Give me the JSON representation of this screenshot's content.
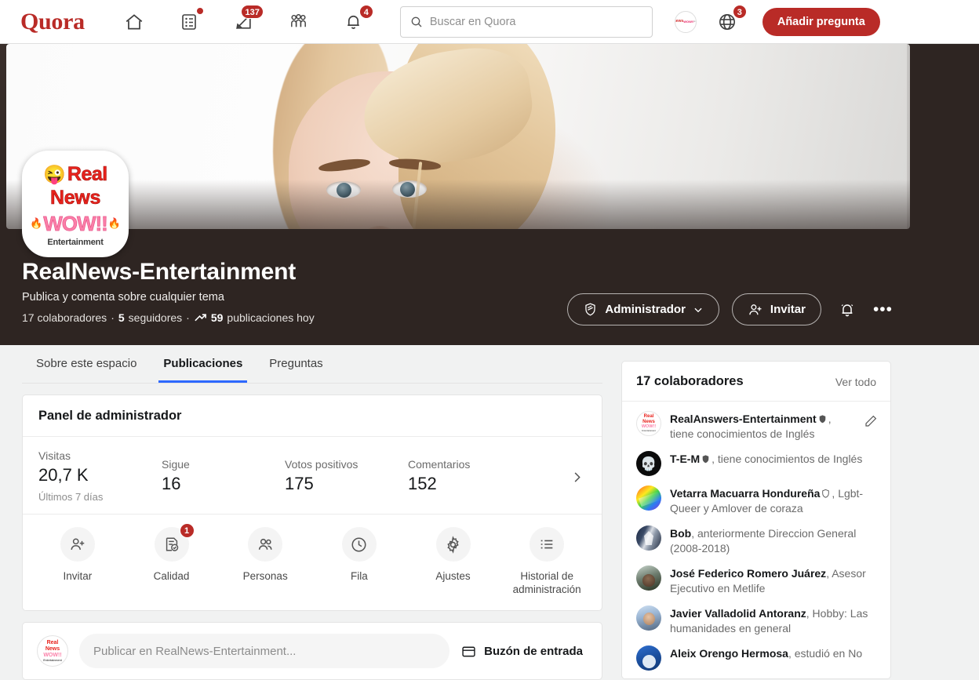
{
  "nav": {
    "logo": "Quora",
    "icons": [
      {
        "name": "home-icon",
        "badge": null
      },
      {
        "name": "spaces-list-icon",
        "badge": "dot"
      },
      {
        "name": "answer-pencil-icon",
        "badge": "137"
      },
      {
        "name": "following-people-icon",
        "badge": null
      },
      {
        "name": "notifications-bell-icon",
        "badge": "4"
      }
    ],
    "search": {
      "placeholder": "Buscar en Quora",
      "value": ""
    },
    "globe_badge": "3",
    "add_question_label": "Añadir pregunta",
    "accent_color": "#b92b27"
  },
  "space": {
    "logo_text": {
      "emoji": "😜",
      "line1": "Real",
      "line2": "News",
      "line3": "WOW!!",
      "fire": "🔥",
      "line4": "Entertainment"
    },
    "title": "RealNews-Entertainment",
    "description": "Publica y comenta sobre cualquier tema",
    "stats_contributors": "17 colaboradores",
    "sep1": "·",
    "stats_followers_num": "5",
    "stats_followers_word": "seguidores",
    "sep2": "·",
    "trend_icon": "trending-up-icon",
    "stats_posts_num": "59",
    "stats_posts_word": "publicaciones hoy",
    "admin_label": "Administrador",
    "invite_label": "Invitar",
    "bell_icon": "notification-bell-icon",
    "more_icon": "more-options-icon"
  },
  "tabs": [
    {
      "label": "Sobre este espacio",
      "active": false
    },
    {
      "label": "Publicaciones",
      "active": true
    },
    {
      "label": "Preguntas",
      "active": false
    }
  ],
  "admin_panel": {
    "title": "Panel de administrador",
    "stats": [
      {
        "label": "Visitas",
        "value": "20,7 K"
      },
      {
        "label": "Sigue",
        "value": "16"
      },
      {
        "label": "Votos positivos",
        "value": "175"
      },
      {
        "label": "Comentarios",
        "value": "152"
      }
    ],
    "period": "Últimos 7 días",
    "actions": [
      {
        "label": "Invitar",
        "icon": "person-add-icon",
        "badge": null
      },
      {
        "label": "Calidad",
        "icon": "quality-check-icon",
        "badge": "1"
      },
      {
        "label": "Personas",
        "icon": "people-icon",
        "badge": null
      },
      {
        "label": "Fila",
        "icon": "clock-queue-icon",
        "badge": null
      },
      {
        "label": "Ajustes",
        "icon": "gear-icon",
        "badge": null
      },
      {
        "label": "Historial de administración",
        "icon": "list-history-icon",
        "badge": null
      }
    ]
  },
  "composer": {
    "placeholder": "Publicar en RealNews-Entertainment...",
    "value": "",
    "inbox_label": "Buzón de entrada",
    "inbox_icon": "inbox-icon"
  },
  "contributors": {
    "title": "17 colaboradores",
    "see_all": "Ver todo",
    "items": [
      {
        "name": "RealAnswers-Entertainment",
        "verified": true,
        "credential": "tiene conocimientos de Inglés",
        "avatar": "av-logo",
        "editable": true
      },
      {
        "name": "T-E-M",
        "verified": true,
        "credential": "tiene conocimientos de Inglés",
        "avatar": "av-skull",
        "editable": false
      },
      {
        "name": "Vetarra Macuarra Hondureña",
        "verified": true,
        "credential": "Lgbt-Queer y Amlover de coraza",
        "avatar": "av-rainbow",
        "editable": false
      },
      {
        "name": "Bob",
        "verified": false,
        "credential": "anteriormente Direccion General (2008-2018)",
        "avatar": "av-flag",
        "editable": false
      },
      {
        "name": "José Federico Romero Juárez",
        "verified": false,
        "credential": "Asesor Ejecutivo en Metlife",
        "avatar": "av-person1",
        "editable": false
      },
      {
        "name": "Javier Valladolid Antoranz",
        "verified": false,
        "credential": "Hobby: Las humanidades en general",
        "avatar": "av-person2",
        "editable": false
      },
      {
        "name": "Aleix Orengo Hermosa",
        "verified": false,
        "credential": "estudió en No",
        "avatar": "av-person3",
        "editable": false
      }
    ]
  }
}
